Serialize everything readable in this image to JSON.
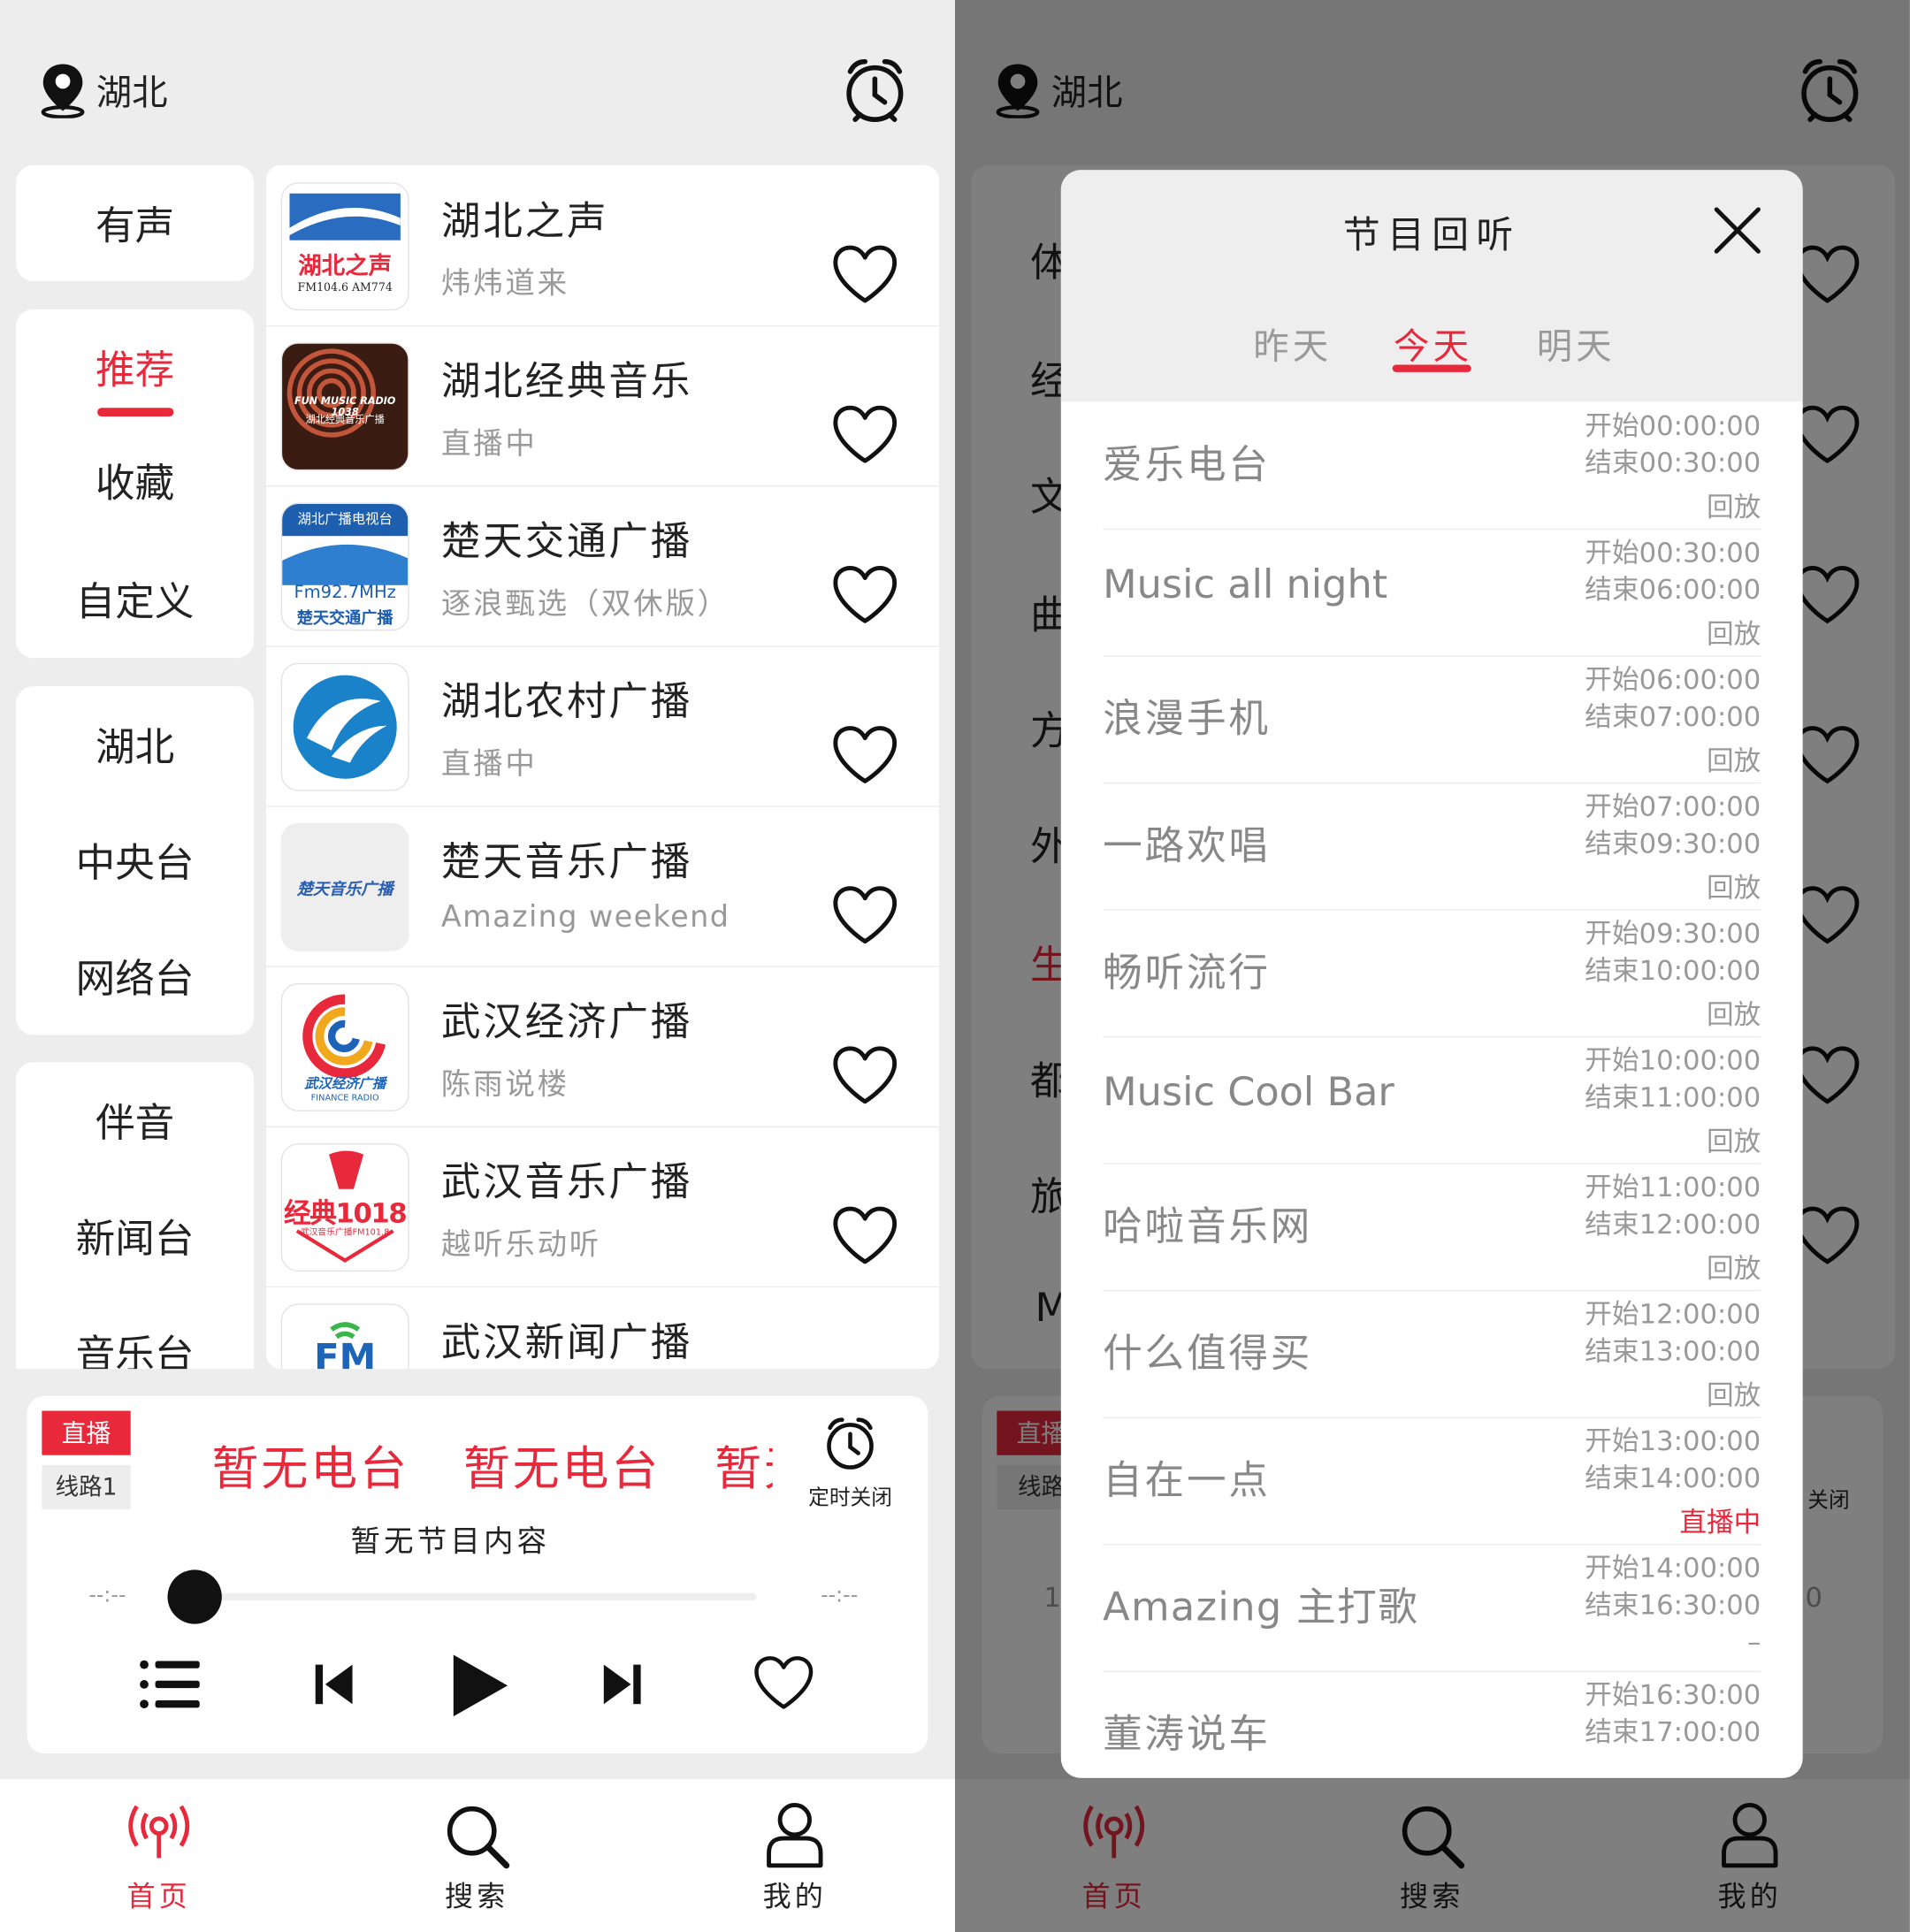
{
  "location": "湖北",
  "categories": {
    "group1": [
      "有声"
    ],
    "group2": [
      "推荐",
      "收藏",
      "自定义"
    ],
    "group3": [
      "湖北",
      "中央台",
      "网络台"
    ],
    "group4": [
      "伴音",
      "新闻台",
      "音乐台"
    ]
  },
  "stations": [
    {
      "name": "湖北之声",
      "sub": "炜炜道来",
      "logo_line1": "湖北之声",
      "logo_line2": "FM104.6 AM774"
    },
    {
      "name": "湖北经典音乐",
      "sub": "直播中",
      "logo_line1": "FUN MUSIC RADIO 1038",
      "logo_line2": "湖北经典音乐广播"
    },
    {
      "name": "楚天交通广播",
      "sub": "逐浪甄选（双休版）",
      "logo_line1": "湖北广播电视台",
      "logo_line2": "Fm92.7MHz",
      "logo_line3": "楚天交通广播"
    },
    {
      "name": "湖北农村广播",
      "sub": "直播中"
    },
    {
      "name": "楚天音乐广播",
      "sub": "Amazing weekend",
      "logo_line1": "楚天音乐广播"
    },
    {
      "name": "武汉经济广播",
      "sub": "陈雨说楼",
      "logo_line1": "武汉经济广播",
      "logo_line2": "FINANCE RADIO"
    },
    {
      "name": "武汉音乐广播",
      "sub": "越听乐动听",
      "logo_line1": "经典1018",
      "logo_line2": "武汉音乐广播FM101.8"
    },
    {
      "name": "武汉新闻广播",
      "sub": "",
      "logo_line1": "FM"
    }
  ],
  "player": {
    "badge_live": "直播",
    "badge_line": "线路1",
    "marquee": [
      "暂无电台",
      "暂无电台",
      "暂无电台"
    ],
    "timer_label": "定时关闭",
    "program": "暂无节目内容",
    "time_start": "--:--",
    "time_end": "--:--",
    "progress": 0
  },
  "nav": [
    {
      "label": "首页",
      "icon": "radio-icon",
      "active": true
    },
    {
      "label": "搜索",
      "icon": "search-icon",
      "active": false
    },
    {
      "label": "我的",
      "icon": "user-icon",
      "active": false
    }
  ],
  "right_background": {
    "categories_partial": [
      "体",
      "经",
      "文",
      "曲",
      "方",
      "外",
      "生",
      "都",
      "旅",
      "M"
    ],
    "badge_live_partial": "直播",
    "badge_line_partial": "线路",
    "timer_partial": "关闭",
    "time_left_partial": "1",
    "time_right_partial": "0"
  },
  "modal": {
    "title": "节目回听",
    "tabs": [
      "昨天",
      "今天",
      "明天"
    ],
    "active_tab": 1,
    "programs": [
      {
        "name": "爱乐电台",
        "start": "开始00:00:00",
        "end": "结束00:30:00",
        "status": "回放",
        "live": false
      },
      {
        "name": "Music all night",
        "start": "开始00:30:00",
        "end": "结束06:00:00",
        "status": "回放",
        "live": false
      },
      {
        "name": "浪漫手机",
        "start": "开始06:00:00",
        "end": "结束07:00:00",
        "status": "回放",
        "live": false
      },
      {
        "name": "一路欢唱",
        "start": "开始07:00:00",
        "end": "结束09:30:00",
        "status": "回放",
        "live": false
      },
      {
        "name": "畅听流行",
        "start": "开始09:30:00",
        "end": "结束10:00:00",
        "status": "回放",
        "live": false
      },
      {
        "name": "Music Cool Bar",
        "start": "开始10:00:00",
        "end": "结束11:00:00",
        "status": "回放",
        "live": false
      },
      {
        "name": "哈啦音乐网",
        "start": "开始11:00:00",
        "end": "结束12:00:00",
        "status": "回放",
        "live": false
      },
      {
        "name": "什么值得买",
        "start": "开始12:00:00",
        "end": "结束13:00:00",
        "status": "回放",
        "live": false
      },
      {
        "name": "自在一点",
        "start": "开始13:00:00",
        "end": "结束14:00:00",
        "status": "直播中",
        "live": true
      },
      {
        "name": "Amazing 主打歌",
        "start": "开始14:00:00",
        "end": "结束16:30:00",
        "status": "–",
        "live": false
      },
      {
        "name": "董涛说车",
        "start": "开始16:30:00",
        "end": "结束17:00:00",
        "status": "",
        "live": false
      }
    ]
  },
  "colors": {
    "accent": "#e8293c",
    "background": "#ededed",
    "text": "#222222",
    "muted": "#999999"
  }
}
